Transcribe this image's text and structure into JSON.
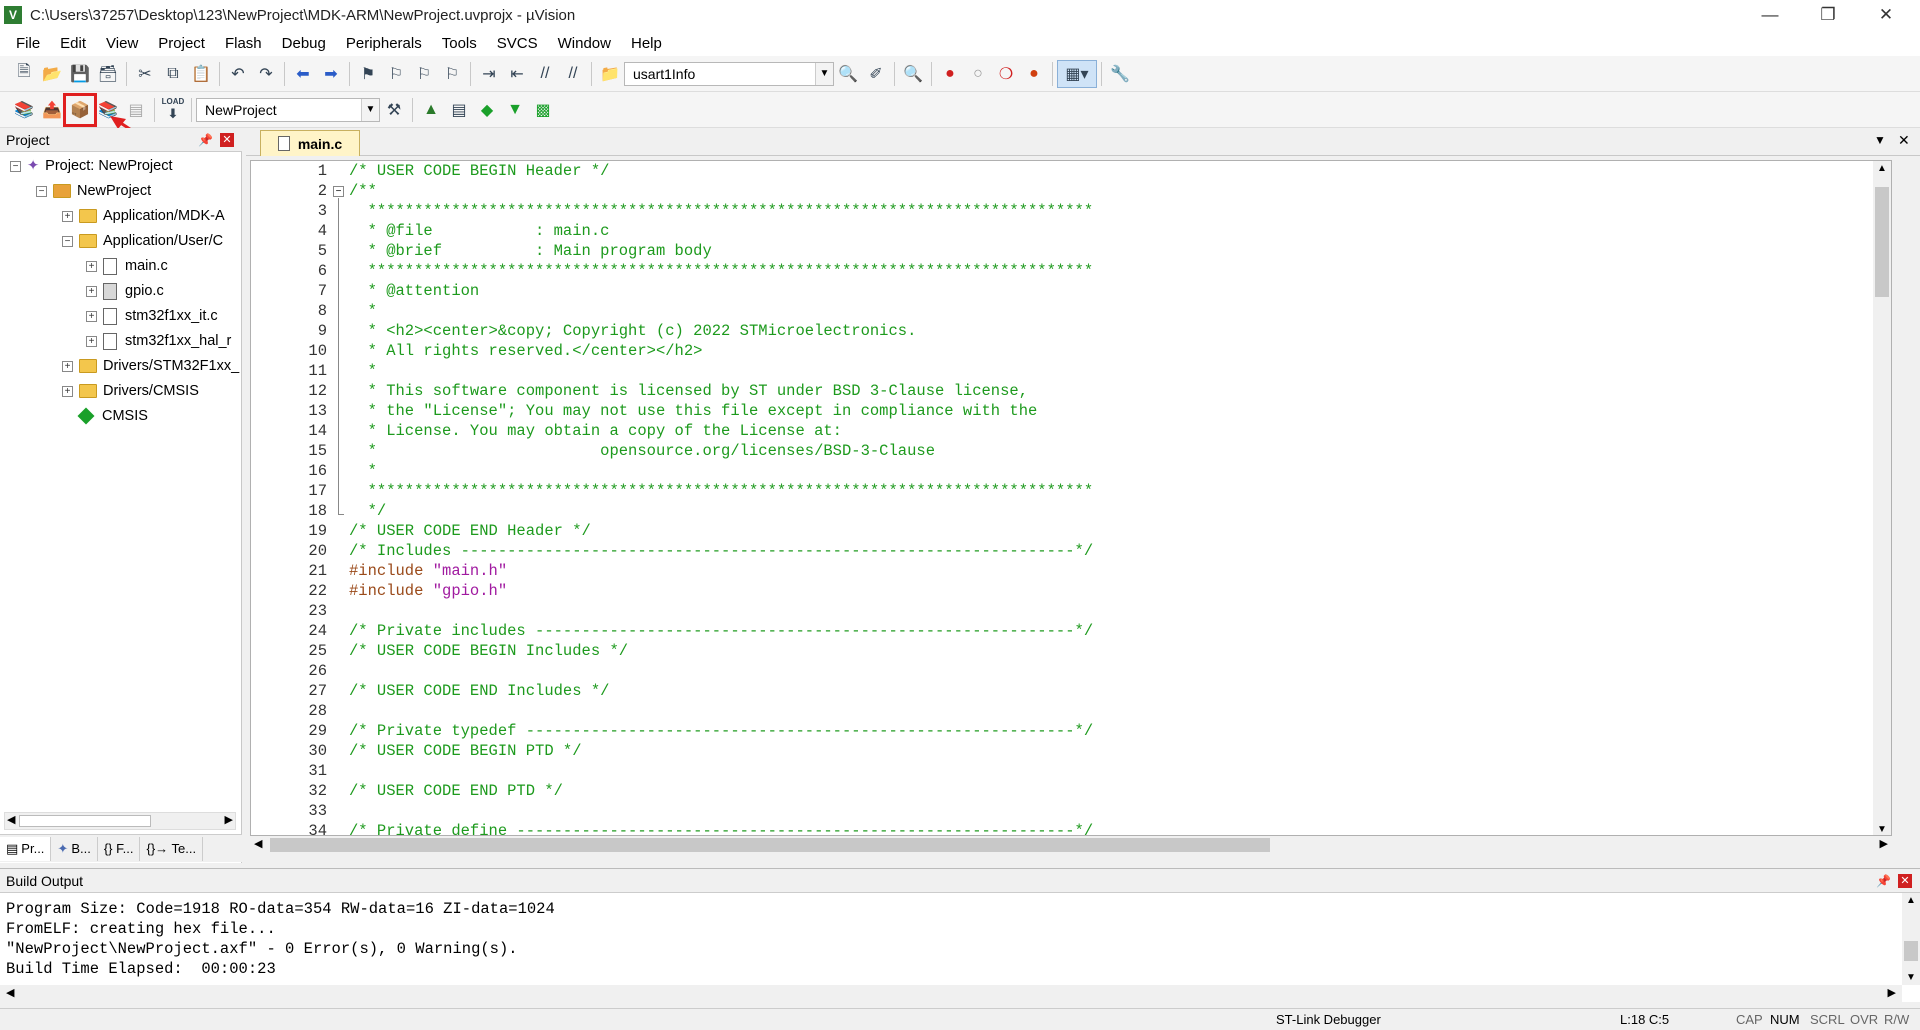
{
  "window": {
    "title": "C:\\Users\\37257\\Desktop\\123\\NewProject\\MDK-ARM\\NewProject.uvprojx - µVision",
    "app_icon": "V"
  },
  "menu": [
    "File",
    "Edit",
    "View",
    "Project",
    "Flash",
    "Debug",
    "Peripherals",
    "Tools",
    "SVCS",
    "Window",
    "Help"
  ],
  "toolbar1": {
    "find_combo_value": "usart1Info"
  },
  "toolbar2": {
    "target_combo_value": "NewProject",
    "load_label": "LOAD"
  },
  "project_panel": {
    "title": "Project",
    "tree": [
      {
        "label": "Project: NewProject",
        "kind": "project"
      },
      {
        "label": "NewProject",
        "kind": "target"
      },
      {
        "label": "Application/MDK-A",
        "kind": "folder"
      },
      {
        "label": "Application/User/C",
        "kind": "folder"
      },
      {
        "label": "main.c",
        "kind": "file"
      },
      {
        "label": "gpio.c",
        "kind": "file"
      },
      {
        "label": "stm32f1xx_it.c",
        "kind": "file"
      },
      {
        "label": "stm32f1xx_hal_r",
        "kind": "file"
      },
      {
        "label": "Drivers/STM32F1xx_",
        "kind": "folder"
      },
      {
        "label": "Drivers/CMSIS",
        "kind": "folder"
      },
      {
        "label": "CMSIS",
        "kind": "component"
      }
    ],
    "bottom_tabs": [
      "Pr...",
      "B...",
      "{} F...",
      "{}→ Te..."
    ]
  },
  "editor": {
    "active_tab": "main.c",
    "lines": [
      {
        "n": "1",
        "text": "/* USER CODE BEGIN Header */",
        "cls": "cmt"
      },
      {
        "n": "2",
        "text": "/**",
        "cls": "cmt"
      },
      {
        "n": "3",
        "text": "  ******************************************************************************",
        "cls": "cmt"
      },
      {
        "n": "4",
        "text": "  * @file           : main.c",
        "cls": "cmt"
      },
      {
        "n": "5",
        "text": "  * @brief          : Main program body",
        "cls": "cmt"
      },
      {
        "n": "6",
        "text": "  ******************************************************************************",
        "cls": "cmt"
      },
      {
        "n": "7",
        "text": "  * @attention",
        "cls": "cmt"
      },
      {
        "n": "8",
        "text": "  *",
        "cls": "cmt"
      },
      {
        "n": "9",
        "text": "  * <h2><center>&copy; Copyright (c) 2022 STMicroelectronics.",
        "cls": "cmt"
      },
      {
        "n": "10",
        "text": "  * All rights reserved.</center></h2>",
        "cls": "cmt"
      },
      {
        "n": "11",
        "text": "  *",
        "cls": "cmt"
      },
      {
        "n": "12",
        "text": "  * This software component is licensed by ST under BSD 3-Clause license,",
        "cls": "cmt"
      },
      {
        "n": "13",
        "text": "  * the \"License\"; You may not use this file except in compliance with the",
        "cls": "cmt"
      },
      {
        "n": "14",
        "text": "  * License. You may obtain a copy of the License at:",
        "cls": "cmt"
      },
      {
        "n": "15",
        "text": "  *                        opensource.org/licenses/BSD-3-Clause",
        "cls": "cmt"
      },
      {
        "n": "16",
        "text": "  *",
        "cls": "cmt"
      },
      {
        "n": "17",
        "text": "  ******************************************************************************",
        "cls": "cmt"
      },
      {
        "n": "18",
        "text": "  */",
        "cls": "cmt"
      },
      {
        "n": "19",
        "text": "/* USER CODE END Header */",
        "cls": "cmt"
      },
      {
        "n": "20",
        "text": "/* Includes ------------------------------------------------------------------*/",
        "cls": "cmt"
      },
      {
        "n": "21",
        "text": "#include \"main.h\"",
        "cls": "pre"
      },
      {
        "n": "22",
        "text": "#include \"gpio.h\"",
        "cls": "pre"
      },
      {
        "n": "23",
        "text": "",
        "cls": "cmt"
      },
      {
        "n": "24",
        "text": "/* Private includes ----------------------------------------------------------*/",
        "cls": "cmt"
      },
      {
        "n": "25",
        "text": "/* USER CODE BEGIN Includes */",
        "cls": "cmt"
      },
      {
        "n": "26",
        "text": "",
        "cls": "cmt"
      },
      {
        "n": "27",
        "text": "/* USER CODE END Includes */",
        "cls": "cmt"
      },
      {
        "n": "28",
        "text": "",
        "cls": "cmt"
      },
      {
        "n": "29",
        "text": "/* Private typedef -----------------------------------------------------------*/",
        "cls": "cmt"
      },
      {
        "n": "30",
        "text": "/* USER CODE BEGIN PTD */",
        "cls": "cmt"
      },
      {
        "n": "31",
        "text": "",
        "cls": "cmt"
      },
      {
        "n": "32",
        "text": "/* USER CODE END PTD */",
        "cls": "cmt"
      },
      {
        "n": "33",
        "text": "",
        "cls": "cmt"
      },
      {
        "n": "34",
        "text": "/* Private define ------------------------------------------------------------*/",
        "cls": "cmt"
      }
    ]
  },
  "build_output": {
    "title": "Build Output",
    "lines": [
      "Program Size: Code=1918 RO-data=354 RW-data=16 ZI-data=1024",
      "FromELF: creating hex file...",
      "\"NewProject\\NewProject.axf\" - 0 Error(s), 0 Warning(s).",
      "Build Time Elapsed:  00:00:23"
    ]
  },
  "statusbar": {
    "debugger": "ST-Link Debugger",
    "position": "L:18 C:5",
    "cap": "CAP",
    "num": "NUM",
    "scrl": "SCRL",
    "ovr": "OVR",
    "rw": "R/W"
  }
}
